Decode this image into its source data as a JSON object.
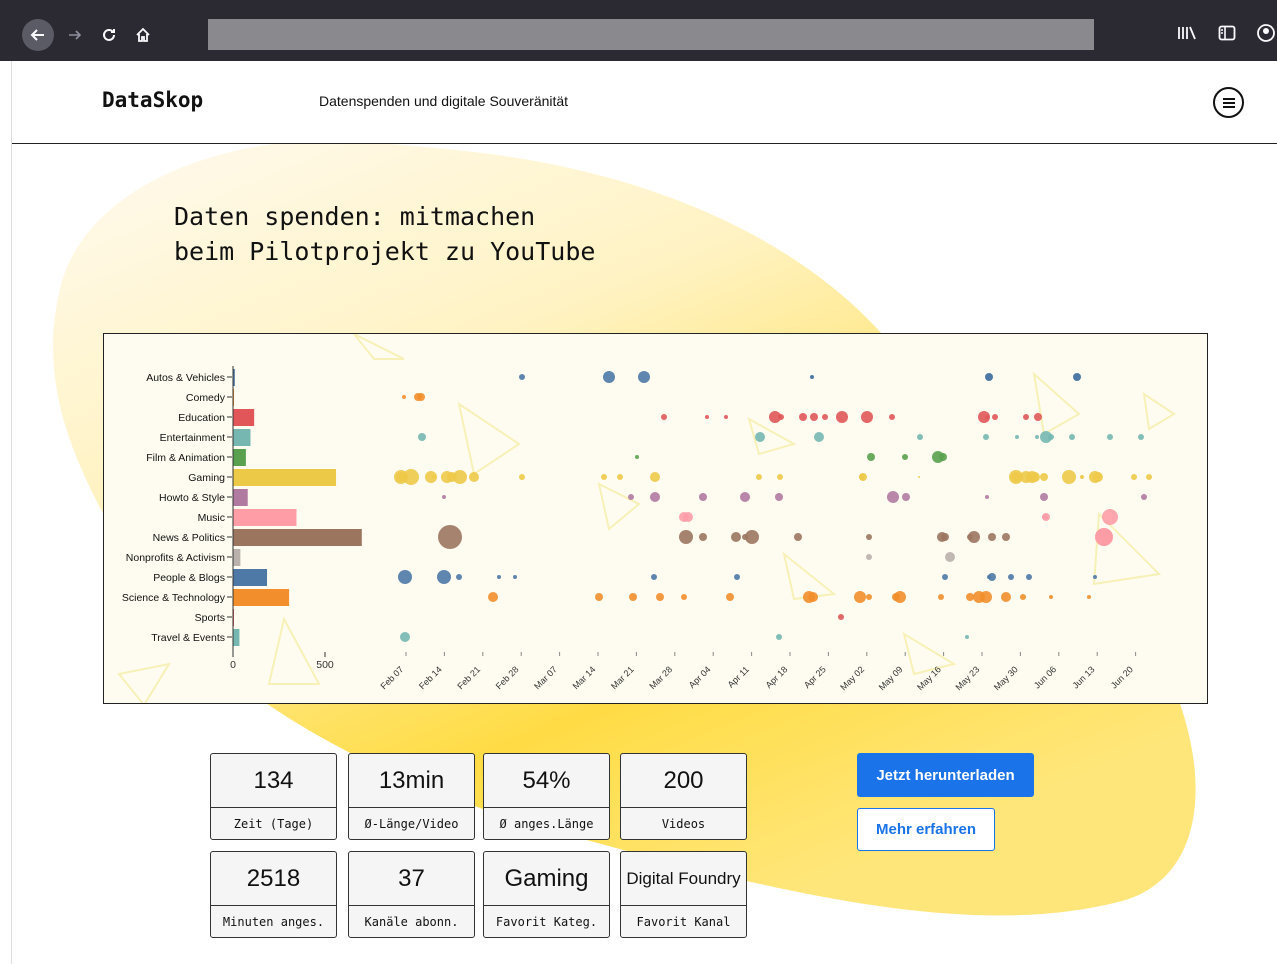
{
  "browser": {
    "back_icon": "arrow-left-icon",
    "forward_icon": "arrow-right-icon",
    "reload_icon": "reload-icon",
    "home_icon": "home-icon",
    "library_icon": "library-icon",
    "sidebar_icon": "sidebar-icon",
    "account_icon": "account-icon"
  },
  "header": {
    "logo": "DataSkop",
    "tagline": "Datenspenden und digitale Souveränität",
    "menu_icon": "hamburger-menu-icon"
  },
  "hero": {
    "title_line1": "Daten spenden: mitmachen",
    "title_line2": "beim Pilotprojekt zu YouTube"
  },
  "chart_data": {
    "type": "bar",
    "title": "",
    "categories": [
      "Autos & Vehicles",
      "Comedy",
      "Education",
      "Entertainment",
      "Film & Animation",
      "Gaming",
      "Howto & Style",
      "Music",
      "News & Politics",
      "Nonprofits & Activism",
      "People & Blogs",
      "Science & Technology",
      "Sports",
      "Travel & Events"
    ],
    "values": [
      10,
      2,
      115,
      95,
      70,
      560,
      80,
      345,
      700,
      40,
      185,
      305,
      5,
      35
    ],
    "colors": [
      "#4e79a7",
      "#f28e2b",
      "#e15759",
      "#76b7b2",
      "#59a14f",
      "#edc948",
      "#b07aa1",
      "#ff9da7",
      "#9c755f",
      "#bab0ac",
      "#4e79a7",
      "#f28e2b",
      "#e15759",
      "#76b7b2"
    ],
    "x_ticks": [
      "0",
      "500"
    ],
    "xlim": [
      0,
      700
    ],
    "timeline": {
      "type": "scatter",
      "x_ticks": [
        "Feb 07",
        "Feb 14",
        "Feb 21",
        "Feb 28",
        "Mar 07",
        "Mar 14",
        "Mar 21",
        "Mar 28",
        "Apr 04",
        "Apr 11",
        "Apr 18",
        "Apr 25",
        "May 02",
        "May 09",
        "May 16",
        "May 23",
        "May 30",
        "Jun 06",
        "Jun 13",
        "Jun 20"
      ]
    }
  },
  "stats": [
    {
      "value": "134",
      "label": "Zeit (Tage)"
    },
    {
      "value": "13min",
      "label": "Ø-Länge/Video"
    },
    {
      "value": "54%",
      "label": "Ø anges.Länge"
    },
    {
      "value": "200",
      "label": "Videos"
    },
    {
      "value": "2518",
      "label": "Minuten anges."
    },
    {
      "value": "37",
      "label": "Kanäle abonn."
    },
    {
      "value": "Gaming",
      "label": "Favorit Kateg."
    },
    {
      "value": "Digital Foundry",
      "label": "Favorit Kanal"
    }
  ],
  "actions": {
    "download_label": "Jetzt herunterladen",
    "learn_more_label": "Mehr erfahren"
  },
  "colors": {
    "accent_blue": "#1a73e8",
    "blob_yellow": "#fdd835"
  }
}
